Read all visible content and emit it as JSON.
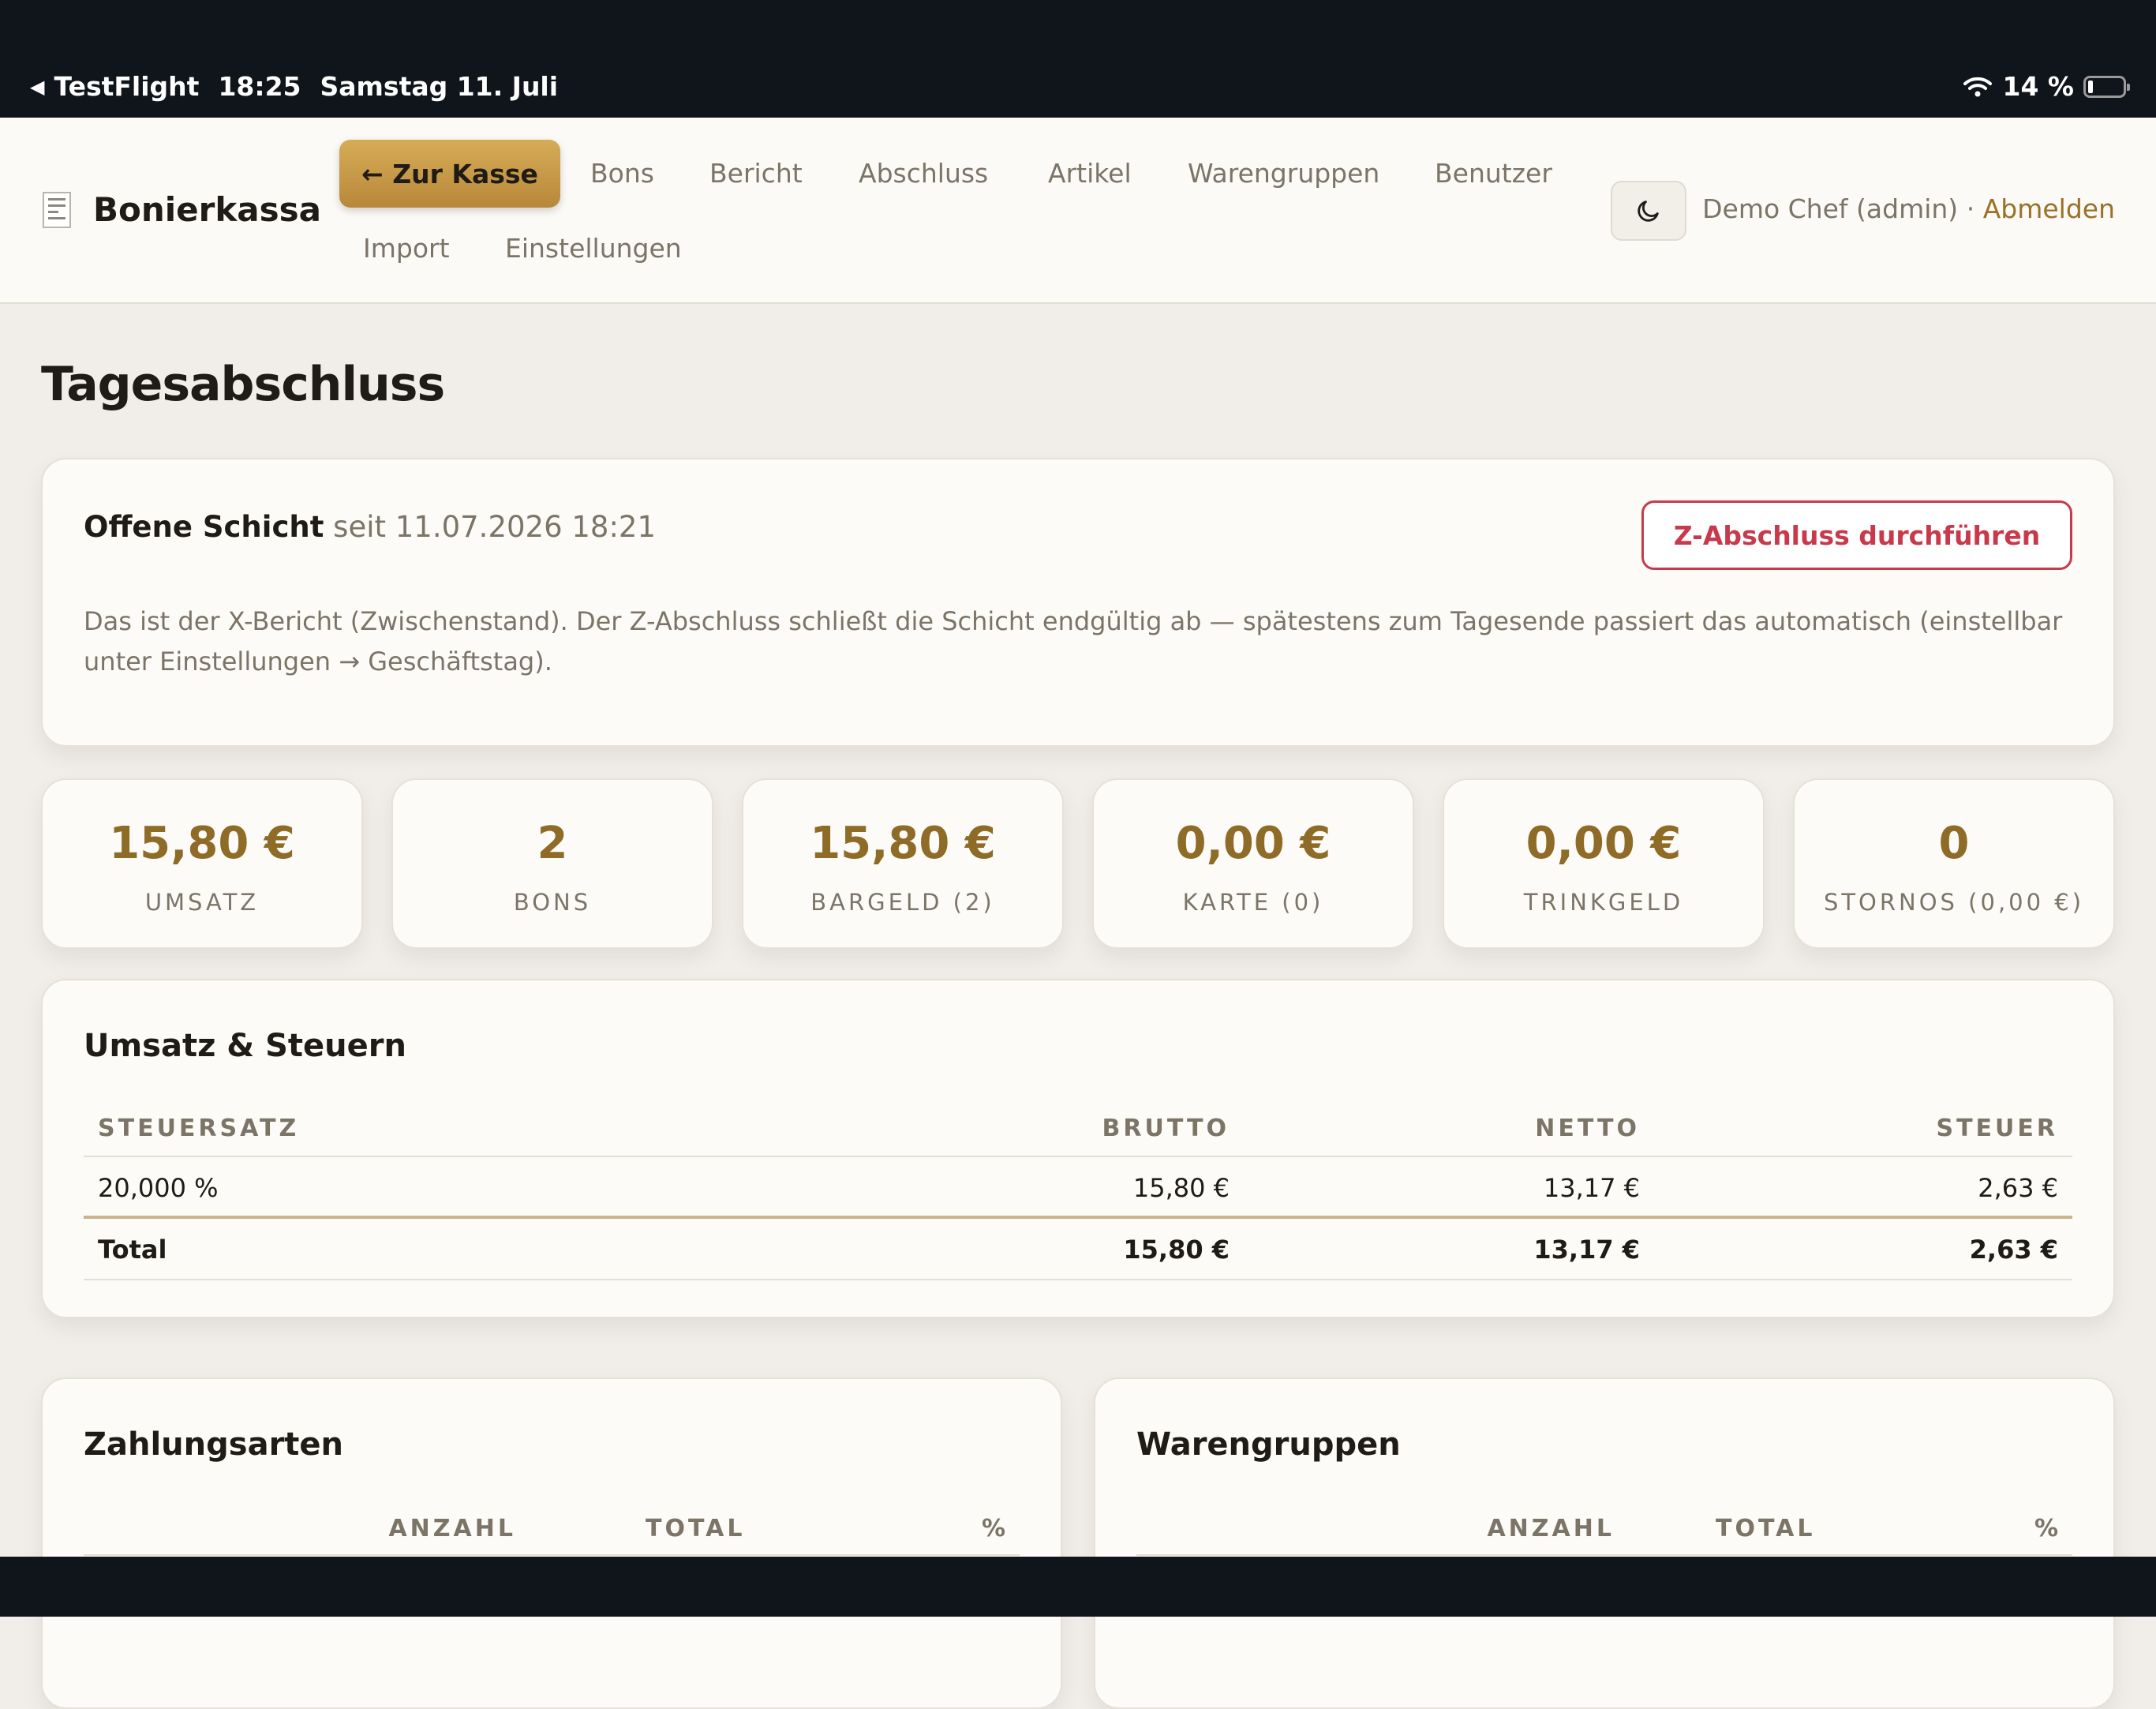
{
  "statusbar": {
    "back_app": "TestFlight",
    "time": "18:25",
    "date": "Samstag 11. Juli",
    "battery": "14 %"
  },
  "brand": {
    "title": "Bonierkassa",
    "icon": "receipt-icon"
  },
  "nav": {
    "kasse_label": "← Zur Kasse",
    "links": [
      "Bons",
      "Bericht",
      "Abschluss",
      "Artikel",
      "Warengruppen",
      "Benutzer",
      "Import",
      "Einstellungen"
    ],
    "user": "Demo Chef (admin)",
    "separator": "·",
    "logout": "Abmelden",
    "theme_icon": "moon-icon"
  },
  "page": {
    "title": "Tagesabschluss"
  },
  "shift": {
    "title": "Offene Schicht",
    "since": "seit 11.07.2026 18:21",
    "z_button": "Z-Abschluss durchführen",
    "description": "Das ist der X-Bericht (Zwischenstand). Der Z-Abschluss schließt die Schicht endgültig ab — spätestens zum Tagesende passiert das automatisch (einstellbar unter Einstellungen → Geschäftstag)."
  },
  "stats": [
    {
      "value": "15,80 €",
      "label": "UMSATZ"
    },
    {
      "value": "2",
      "label": "BONS"
    },
    {
      "value": "15,80 €",
      "label": "BARGELD (2)"
    },
    {
      "value": "0,00 €",
      "label": "KARTE (0)"
    },
    {
      "value": "0,00 €",
      "label": "TRINKGELD"
    },
    {
      "value": "0",
      "label": "STORNOS (0,00 €)"
    }
  ],
  "tax": {
    "title": "Umsatz & Steuern",
    "headers": [
      "STEUERSATZ",
      "BRUTTO",
      "NETTO",
      "STEUER"
    ],
    "rows": [
      [
        "20,000 %",
        "15,80 €",
        "13,17 €",
        "2,63 €"
      ]
    ],
    "total": [
      "Total",
      "15,80 €",
      "13,17 €",
      "2,63 €"
    ]
  },
  "payments": {
    "title": "Zahlungsarten",
    "headers": [
      "ANZAHL",
      "TOTAL",
      "%"
    ]
  },
  "groups": {
    "title": "Warengruppen",
    "headers": [
      "ANZAHL",
      "TOTAL",
      "%"
    ]
  },
  "colors": {
    "accent_gold": "#b8883a",
    "value_gold": "#8e6c27",
    "danger": "#c83a4b",
    "background": "#f1eeea",
    "card": "#fcfbf8"
  }
}
